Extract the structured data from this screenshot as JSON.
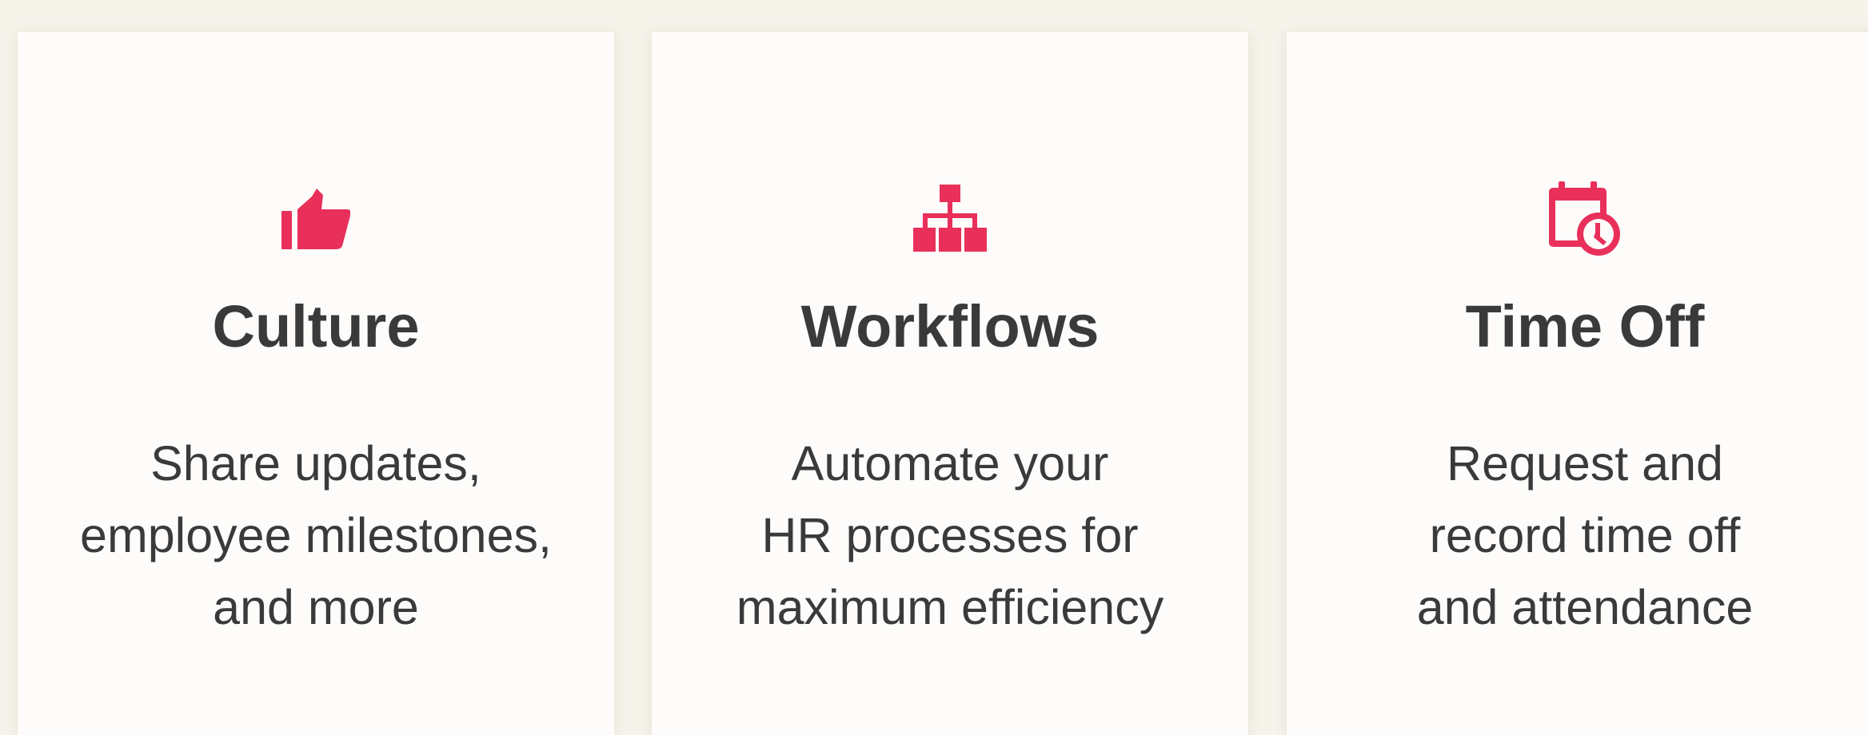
{
  "theme": {
    "background": "#f5f3ea",
    "card_background": "#fdfcfa",
    "accent": "#e8305a",
    "text": "#3a3a3a"
  },
  "cards": [
    {
      "icon": "thumbs-up-icon",
      "title": "Culture",
      "lines": [
        "Share updates,",
        "employee milestones,",
        "and more"
      ]
    },
    {
      "icon": "org-chart-icon",
      "title": "Workflows",
      "lines": [
        "Automate your",
        "HR processes for",
        "maximum efficiency"
      ]
    },
    {
      "icon": "calendar-clock-icon",
      "title": "Time Off",
      "lines": [
        "Request and",
        "record time off",
        "and attendance"
      ]
    }
  ]
}
